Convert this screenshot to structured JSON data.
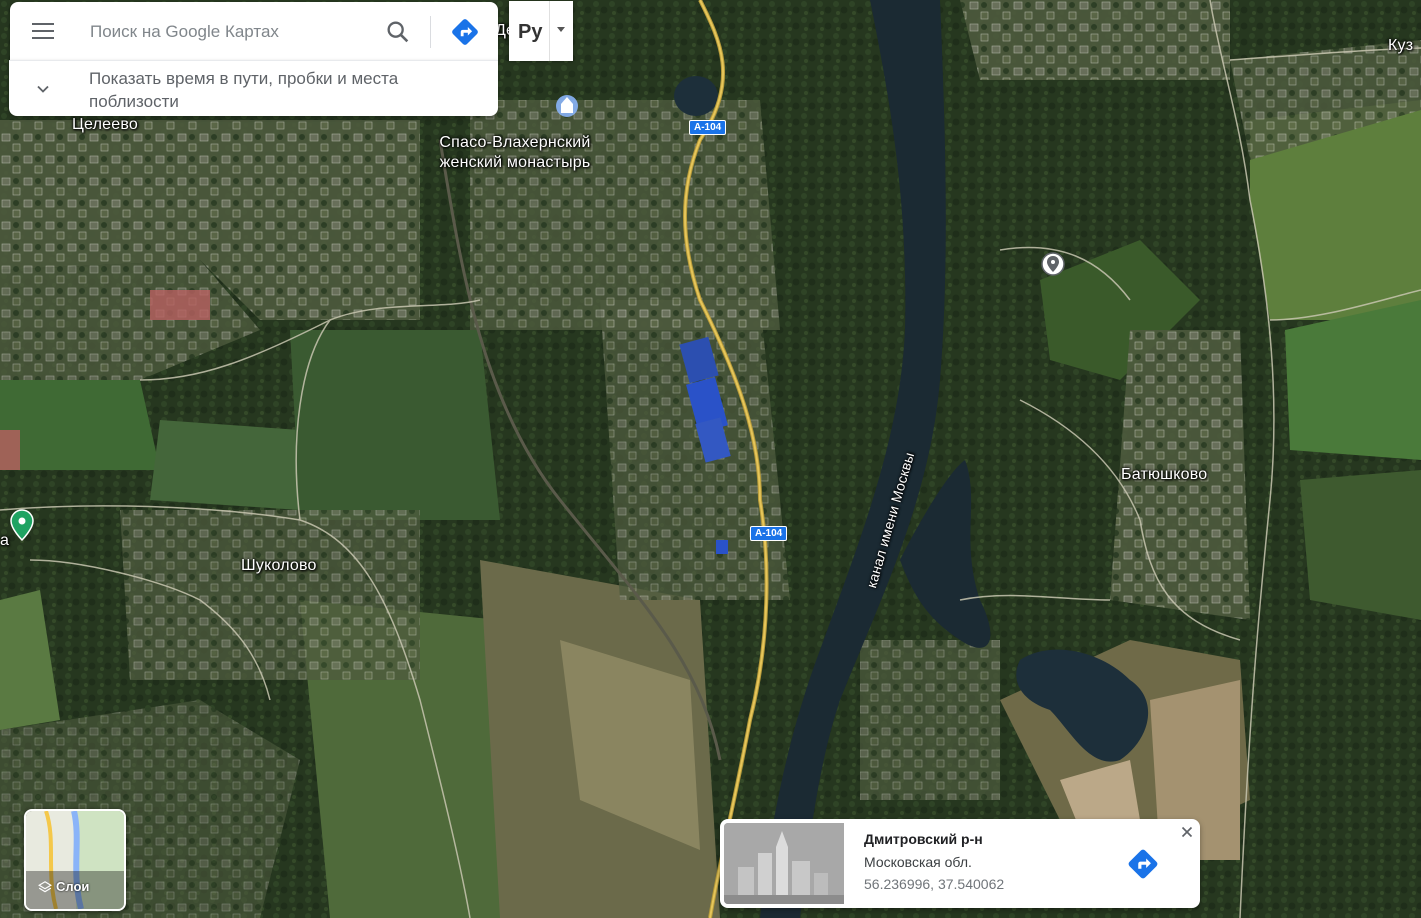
{
  "search": {
    "placeholder": "Поиск на Google Картах",
    "expand_text": "Показать время в пути, пробки и места поблизости"
  },
  "language_button": {
    "label": "Ру"
  },
  "map": {
    "type": "satellite",
    "labels": {
      "place_top_center": "Дедово",
      "village_tseleevo": "Целеево",
      "monastery": "Спасо-Влахернский женский монастырь",
      "village_shukolovo": "Шуколово",
      "village_batyushkovo": "Батюшково",
      "canal": "канал имени Москвы",
      "top_right_partial": "Куз",
      "left_edge_partial": "а"
    },
    "road_shields": [
      "А-104",
      "А-104"
    ]
  },
  "layers_button": {
    "label": "Слои"
  },
  "info_card": {
    "title": "Дмитровский р-н",
    "subtitle": "Московская обл.",
    "coordinates": "56.236996, 37.540062"
  },
  "colors": {
    "accent_blue": "#1a73e8",
    "pin_green": "#1ea362",
    "river": "#1b2a33"
  }
}
